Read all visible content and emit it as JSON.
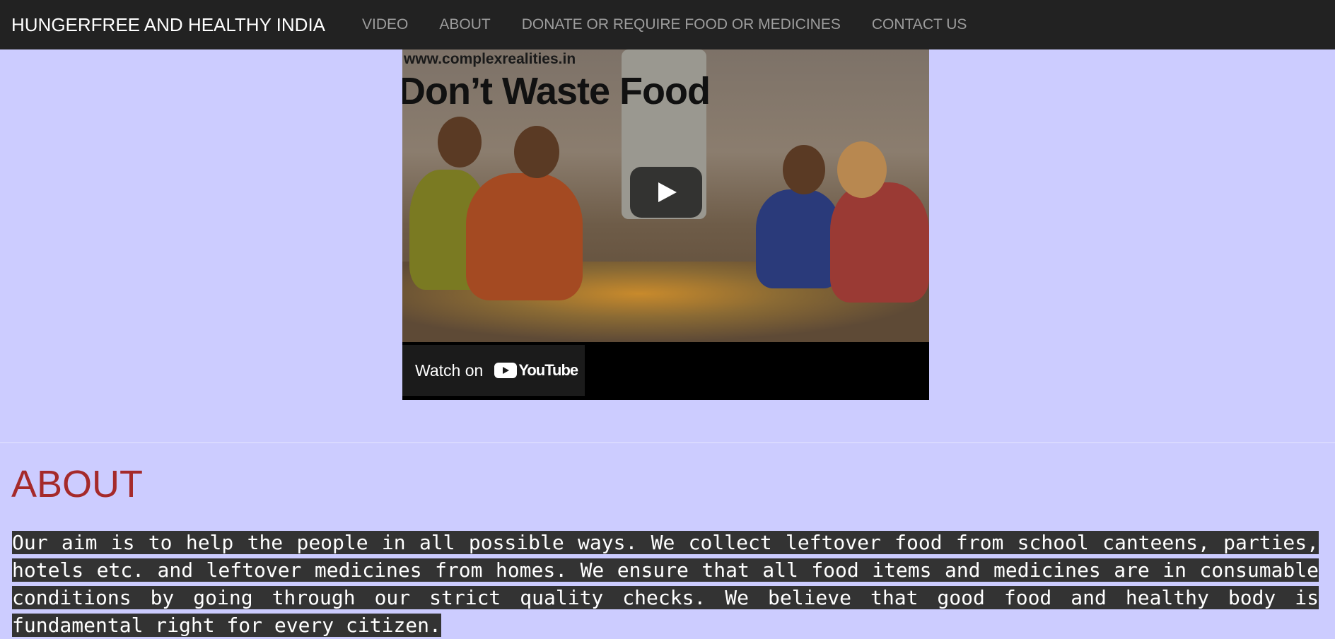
{
  "navbar": {
    "brand": "HUNGERFREE AND HEALTHY INDIA",
    "items": [
      {
        "label": "VIDEO"
      },
      {
        "label": "ABOUT"
      },
      {
        "label": "DONATE OR REQUIRE FOOD OR MEDICINES"
      },
      {
        "label": "CONTACT US"
      }
    ]
  },
  "video": {
    "watermark": "www.complexrealities.in",
    "thumbnail_title": "Don’t Waste Food",
    "watch_label": "Watch on",
    "platform": "YouTube"
  },
  "about": {
    "title": "ABOUT",
    "text": "Our aim is to help the people in all possible ways. We collect leftover food from school canteens, parties, hotels etc. and leftover medicines from homes. We ensure that all food items and medicines are in consumable conditions by going through our strict quality checks. We believe that good food and healthy body is fundamental right for every citizen."
  },
  "colors": {
    "page_background": "#ccccff",
    "navbar_background": "#222222",
    "about_title": "#a52a2a",
    "about_text_background": "#333333"
  }
}
